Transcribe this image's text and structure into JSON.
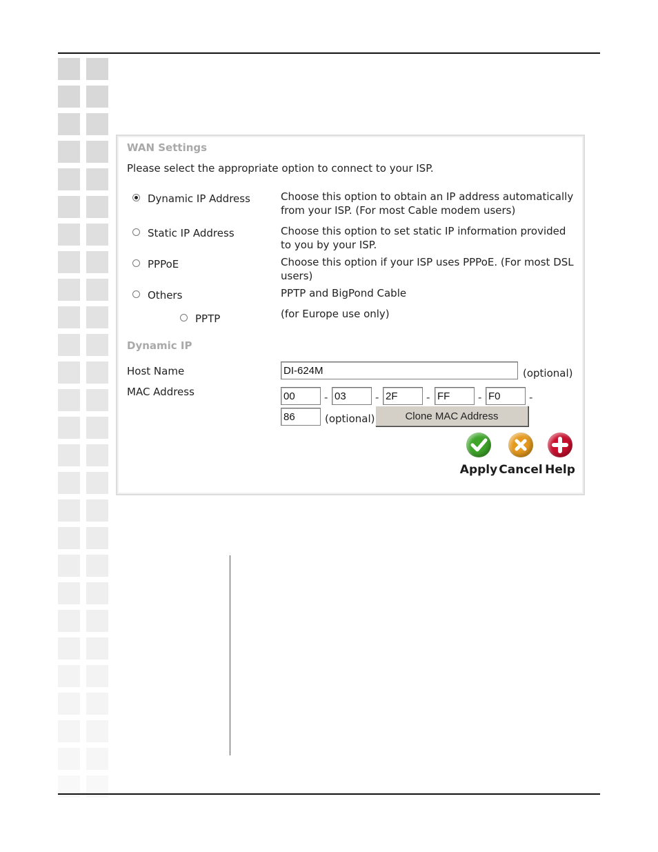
{
  "wan": {
    "title": "WAN Settings",
    "instruction": "Please select the appropriate option to connect to your ISP.",
    "options": [
      {
        "label": "Dynamic IP Address",
        "description": "Choose this option to obtain an IP address automatically from your ISP. (For most Cable modem users)",
        "checked": true
      },
      {
        "label": "Static IP Address",
        "description": "Choose this option to set static IP information provided to you by your ISP.",
        "checked": false
      },
      {
        "label": "PPPoE",
        "description": "Choose this option if your ISP uses PPPoE. (For most DSL users)",
        "checked": false
      },
      {
        "label": "Others",
        "description": "PPTP and BigPond Cable",
        "checked": false
      },
      {
        "label": "PPTP",
        "description": "(for Europe use only)",
        "checked": false
      }
    ]
  },
  "dynamic": {
    "title": "Dynamic IP",
    "host_label": "Host Name",
    "host_value": "DI-624M",
    "host_optional": "(optional)",
    "mac_label": "MAC Address",
    "mac": [
      "00",
      "03",
      "2F",
      "FF",
      "F0",
      "86"
    ],
    "mac_separator": "-",
    "mac_optional": "(optional)",
    "clone_label": "Clone MAC Address"
  },
  "actions": {
    "apply": "Apply",
    "cancel": "Cancel",
    "help": "Help"
  },
  "colors": {
    "apply": "#3fa52a",
    "cancel": "#e59a1e",
    "help": "#c8102e",
    "section_title": "#a9a9a9"
  }
}
